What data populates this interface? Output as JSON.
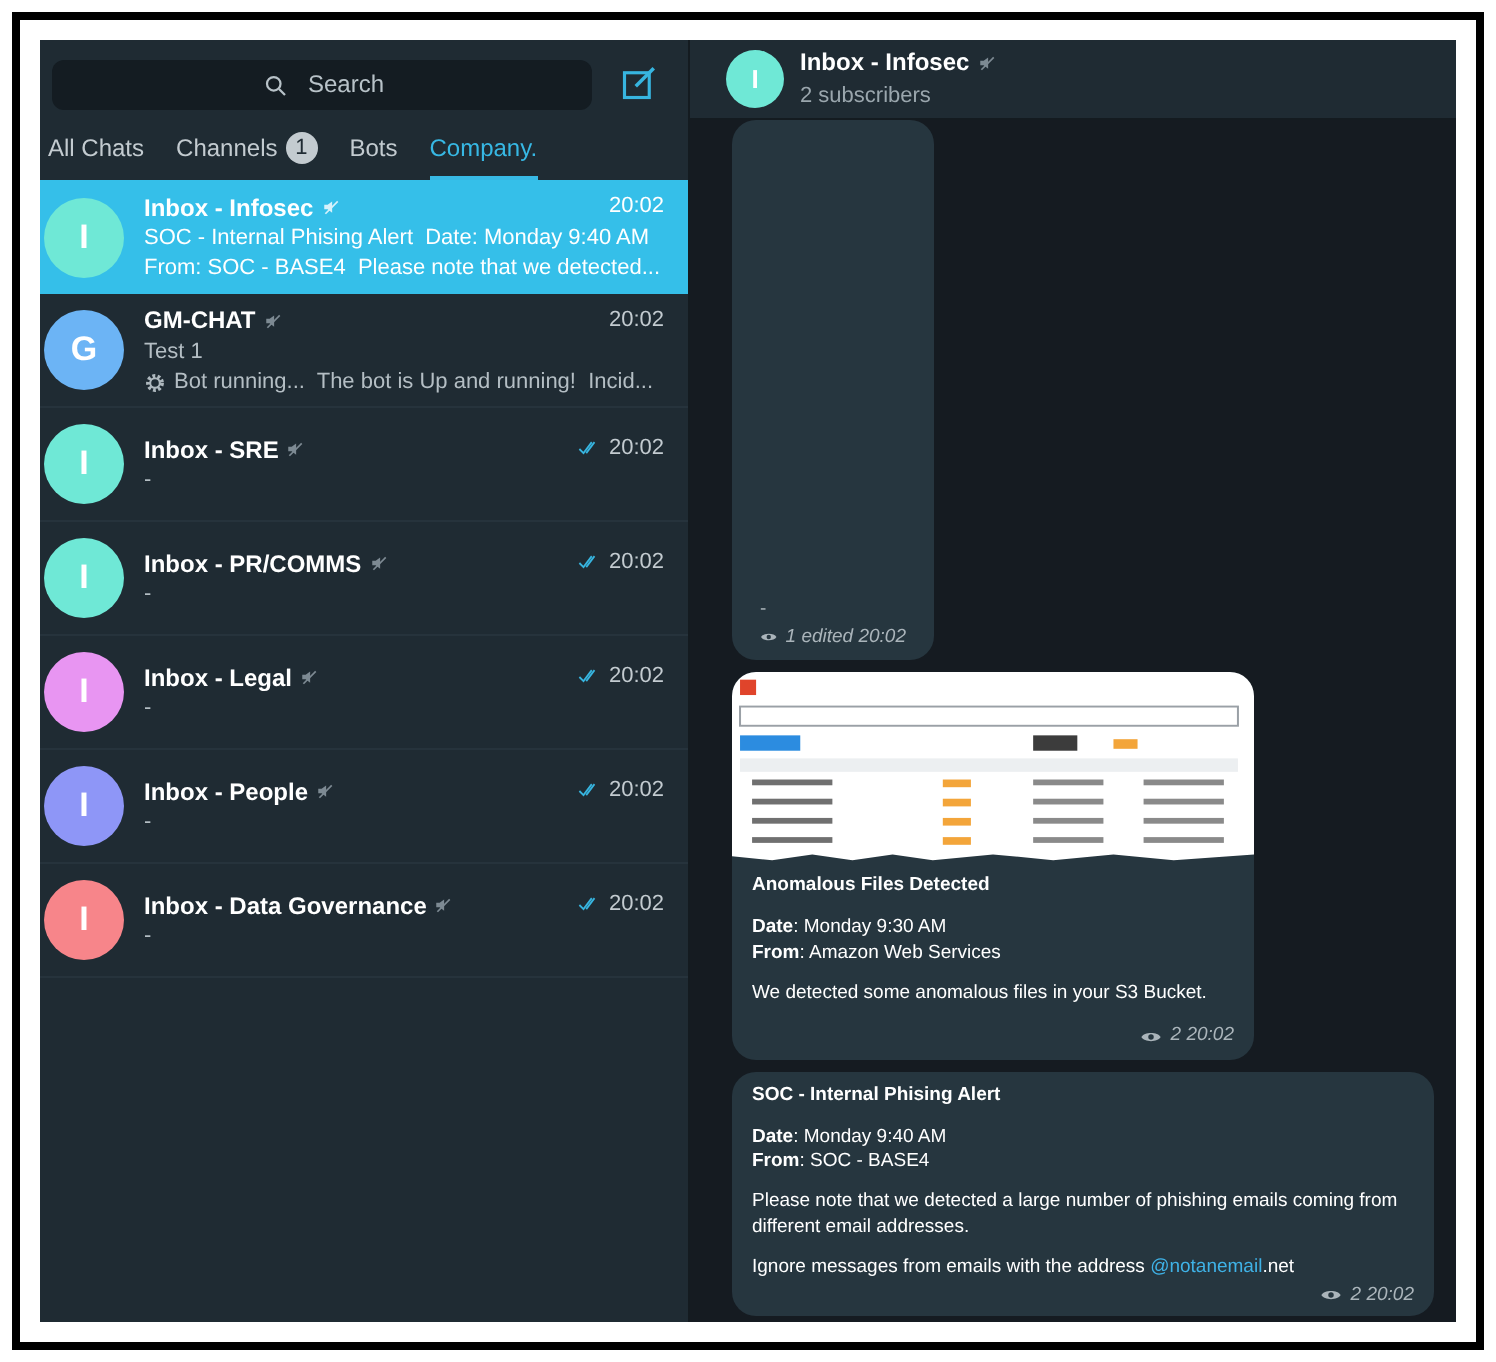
{
  "search": {
    "placeholder": "Search"
  },
  "tabs": [
    {
      "label": "All Chats",
      "selected": false
    },
    {
      "label": "Channels",
      "badge": "1",
      "selected": false
    },
    {
      "label": "Bots",
      "selected": false
    },
    {
      "label": "Company.",
      "selected": true
    }
  ],
  "chats": [
    {
      "initial": "I",
      "color": "#6fe8d6",
      "title": "Inbox - Infosec",
      "muted": true,
      "time": "20:02",
      "read": false,
      "selected": true,
      "lines": [
        {
          "text": "SOC - Internal Phising Alert  Date: Monday 9:40 AM"
        },
        {
          "text": "From: SOC - BASE4  Please note that we detected..."
        }
      ]
    },
    {
      "initial": "G",
      "color": "#6cb4f5",
      "title": "GM-CHAT",
      "muted": true,
      "time": "20:02",
      "read": false,
      "selected": false,
      "lines": [
        {
          "text": "Test 1"
        },
        {
          "text": "Bot running...  The bot is Up and running!  Incid...",
          "gear": true
        }
      ]
    },
    {
      "initial": "I",
      "color": "#6fe8d6",
      "title": "Inbox - SRE",
      "muted": true,
      "time": "20:02",
      "read": true,
      "selected": false,
      "lines": [
        {
          "text": "-"
        }
      ]
    },
    {
      "initial": "I",
      "color": "#6fe8d6",
      "title": "Inbox - PR/COMMS",
      "muted": true,
      "time": "20:02",
      "read": true,
      "selected": false,
      "lines": [
        {
          "text": "-"
        }
      ]
    },
    {
      "initial": "I",
      "color": "#e895f2",
      "title": "Inbox - Legal",
      "muted": true,
      "time": "20:02",
      "read": true,
      "selected": false,
      "lines": [
        {
          "text": "-"
        }
      ]
    },
    {
      "initial": "I",
      "color": "#8e96f7",
      "title": "Inbox - People",
      "muted": true,
      "time": "20:02",
      "read": true,
      "selected": false,
      "lines": [
        {
          "text": "-"
        }
      ]
    },
    {
      "initial": "I",
      "color": "#f7858a",
      "title": "Inbox - Data Governance",
      "muted": true,
      "time": "20:02",
      "read": true,
      "selected": false,
      "lines": [
        {
          "text": "-"
        }
      ]
    }
  ],
  "header": {
    "initial": "I",
    "title": "Inbox - Infosec",
    "muted": true,
    "subtitle": "2 subscribers"
  },
  "messages": [
    {
      "kind": "tall",
      "paragraphs": [
        "-"
      ],
      "meta": "1 edited 20:02"
    },
    {
      "title": "Anomalous Files Detected",
      "paragraphs": [
        "**Date**: Monday 9:30 AM\n**From**: Amazon Web Services",
        "We detected some anomalous files in your S3 Bucket."
      ],
      "meta": "2 20:02"
    },
    {
      "kind": "text",
      "title": "SOC - Internal Phising Alert",
      "paragraphs": [
        "**Date**: Monday 9:40 AM\n**From**: SOC - BASE4",
        "Please note that we detected a large number of phishing emails coming from different email addresses."
      ],
      "link_line": {
        "before": "Ignore messages from emails with the address ",
        "link": "@notanemail",
        "after": ".net"
      },
      "meta": "2 20:02"
    }
  ]
}
